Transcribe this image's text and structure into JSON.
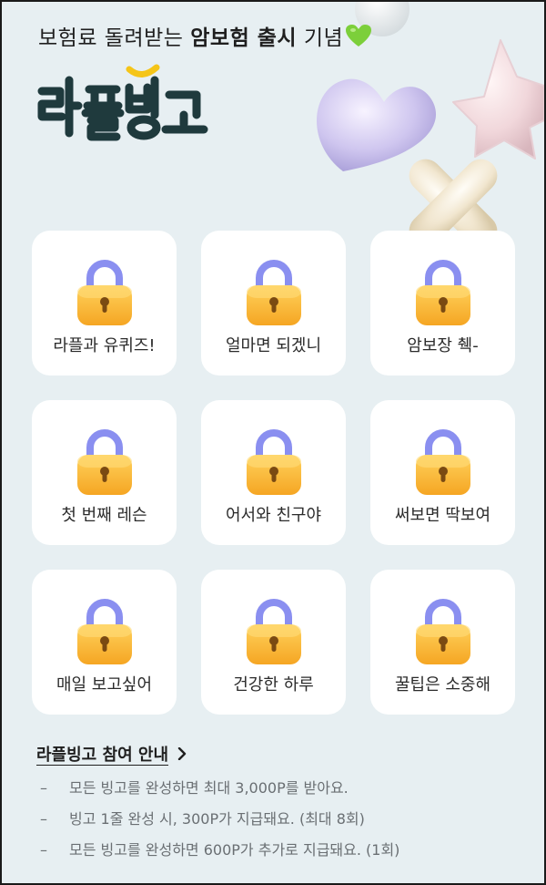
{
  "header": {
    "headline_prefix": "보험료 돌려받는",
    "headline_bold": "암보험 출시",
    "headline_suffix": "기념",
    "headline_emoji": "💚",
    "logo_text": "라플빙고"
  },
  "bingo": {
    "cells": [
      {
        "label": "라플과 유퀴즈!",
        "icon": "lock-icon"
      },
      {
        "label": "얼마면 되겠니",
        "icon": "lock-icon"
      },
      {
        "label": "암보장 췍-",
        "icon": "lock-icon"
      },
      {
        "label": "첫 번째 레슨",
        "icon": "lock-icon"
      },
      {
        "label": "어서와 친구야",
        "icon": "lock-icon"
      },
      {
        "label": "써보면 딱보여",
        "icon": "lock-icon"
      },
      {
        "label": "매일 보고싶어",
        "icon": "lock-icon"
      },
      {
        "label": "건강한 하루",
        "icon": "lock-icon"
      },
      {
        "label": "꿀팁은 소중해",
        "icon": "lock-icon"
      }
    ]
  },
  "info": {
    "title": "라플빙고 참여 안내",
    "items": [
      "모든 빙고를 완성하면 최대 3,000P를 받아요.",
      "빙고 1줄 완성 시, 300P가 지급돼요. (최대 8회)",
      "모든 빙고를  완성하면 600P가 추가로 지급돼요. (1회)"
    ],
    "bullet": "–"
  },
  "colors": {
    "background": "#e7eff2",
    "logo": "#1f3a3d",
    "logo_accent": "#f5c518",
    "lock_body": "#fbbd3c",
    "lock_shackle": "#8a8ff0"
  }
}
